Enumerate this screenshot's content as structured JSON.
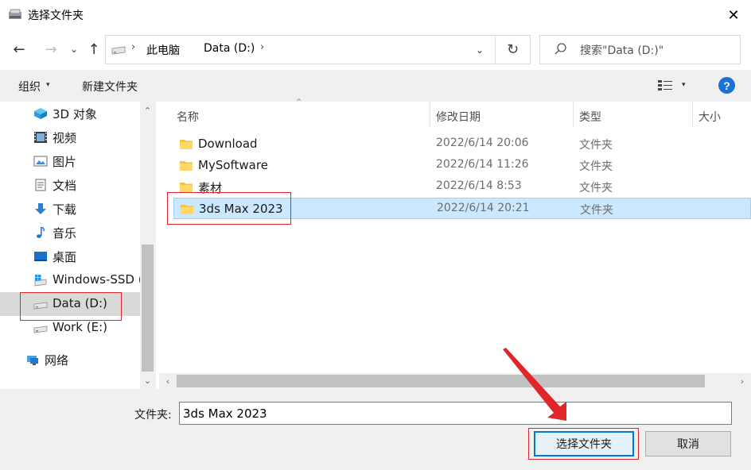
{
  "window": {
    "title": "选择文件夹",
    "close_glyph": "✕"
  },
  "nav": {
    "back_glyph": "←",
    "forward_glyph": "→",
    "recent_glyph": "⌄",
    "up_glyph": "↑",
    "refresh_glyph": "↻",
    "dropdown_glyph": "⌄",
    "breadcrumb_sep": "›",
    "breadcrumbs": [
      "此电脑",
      "Data (D:)"
    ],
    "search_placeholder": "搜索\"Data (D:)\""
  },
  "toolbar": {
    "organize_label": "组织",
    "new_folder_label": "新建文件夹",
    "caret_glyph": "▾",
    "help_label": "?"
  },
  "sidebar": {
    "items": [
      {
        "label": "3D 对象",
        "icon": "3d-objects-icon"
      },
      {
        "label": "视频",
        "icon": "video-icon"
      },
      {
        "label": "图片",
        "icon": "pictures-icon"
      },
      {
        "label": "文档",
        "icon": "documents-icon"
      },
      {
        "label": "下载",
        "icon": "downloads-icon"
      },
      {
        "label": "音乐",
        "icon": "music-icon"
      },
      {
        "label": "桌面",
        "icon": "desktop-icon"
      },
      {
        "label": "Windows-SSD (",
        "icon": "windows-drive-icon"
      },
      {
        "label": "Data (D:)",
        "icon": "drive-icon"
      },
      {
        "label": "Work (E:)",
        "icon": "drive-icon"
      },
      {
        "label": "网络",
        "icon": "network-icon"
      }
    ],
    "selected": "Data (D:)",
    "scroll_up_glyph": "⌃",
    "scroll_down_glyph": "⌄"
  },
  "file_list": {
    "columns": [
      "名称",
      "修改日期",
      "类型",
      "大小"
    ],
    "sort_glyph": "^",
    "rows": [
      {
        "name": "Download",
        "date": "2022/6/14 20:06",
        "type": "文件夹"
      },
      {
        "name": "MySoftware",
        "date": "2022/6/14 11:26",
        "type": "文件夹"
      },
      {
        "name": "素材",
        "date": "2022/6/14 8:53",
        "type": "文件夹"
      },
      {
        "name": "3ds Max 2023",
        "date": "2022/6/14 20:21",
        "type": "文件夹"
      }
    ],
    "selected_row": "3ds Max 2023",
    "scroll_left_glyph": "‹",
    "scroll_right_glyph": "›"
  },
  "bottom": {
    "folder_label": "文件夹:",
    "folder_value": "3ds Max 2023",
    "select_button": "选择文件夹",
    "cancel_button": "取消"
  },
  "colors": {
    "accent": "#0078d7",
    "selection_bg": "#cce8ff",
    "annotation_red": "#e0262b",
    "help_blue": "#1a72d6"
  }
}
